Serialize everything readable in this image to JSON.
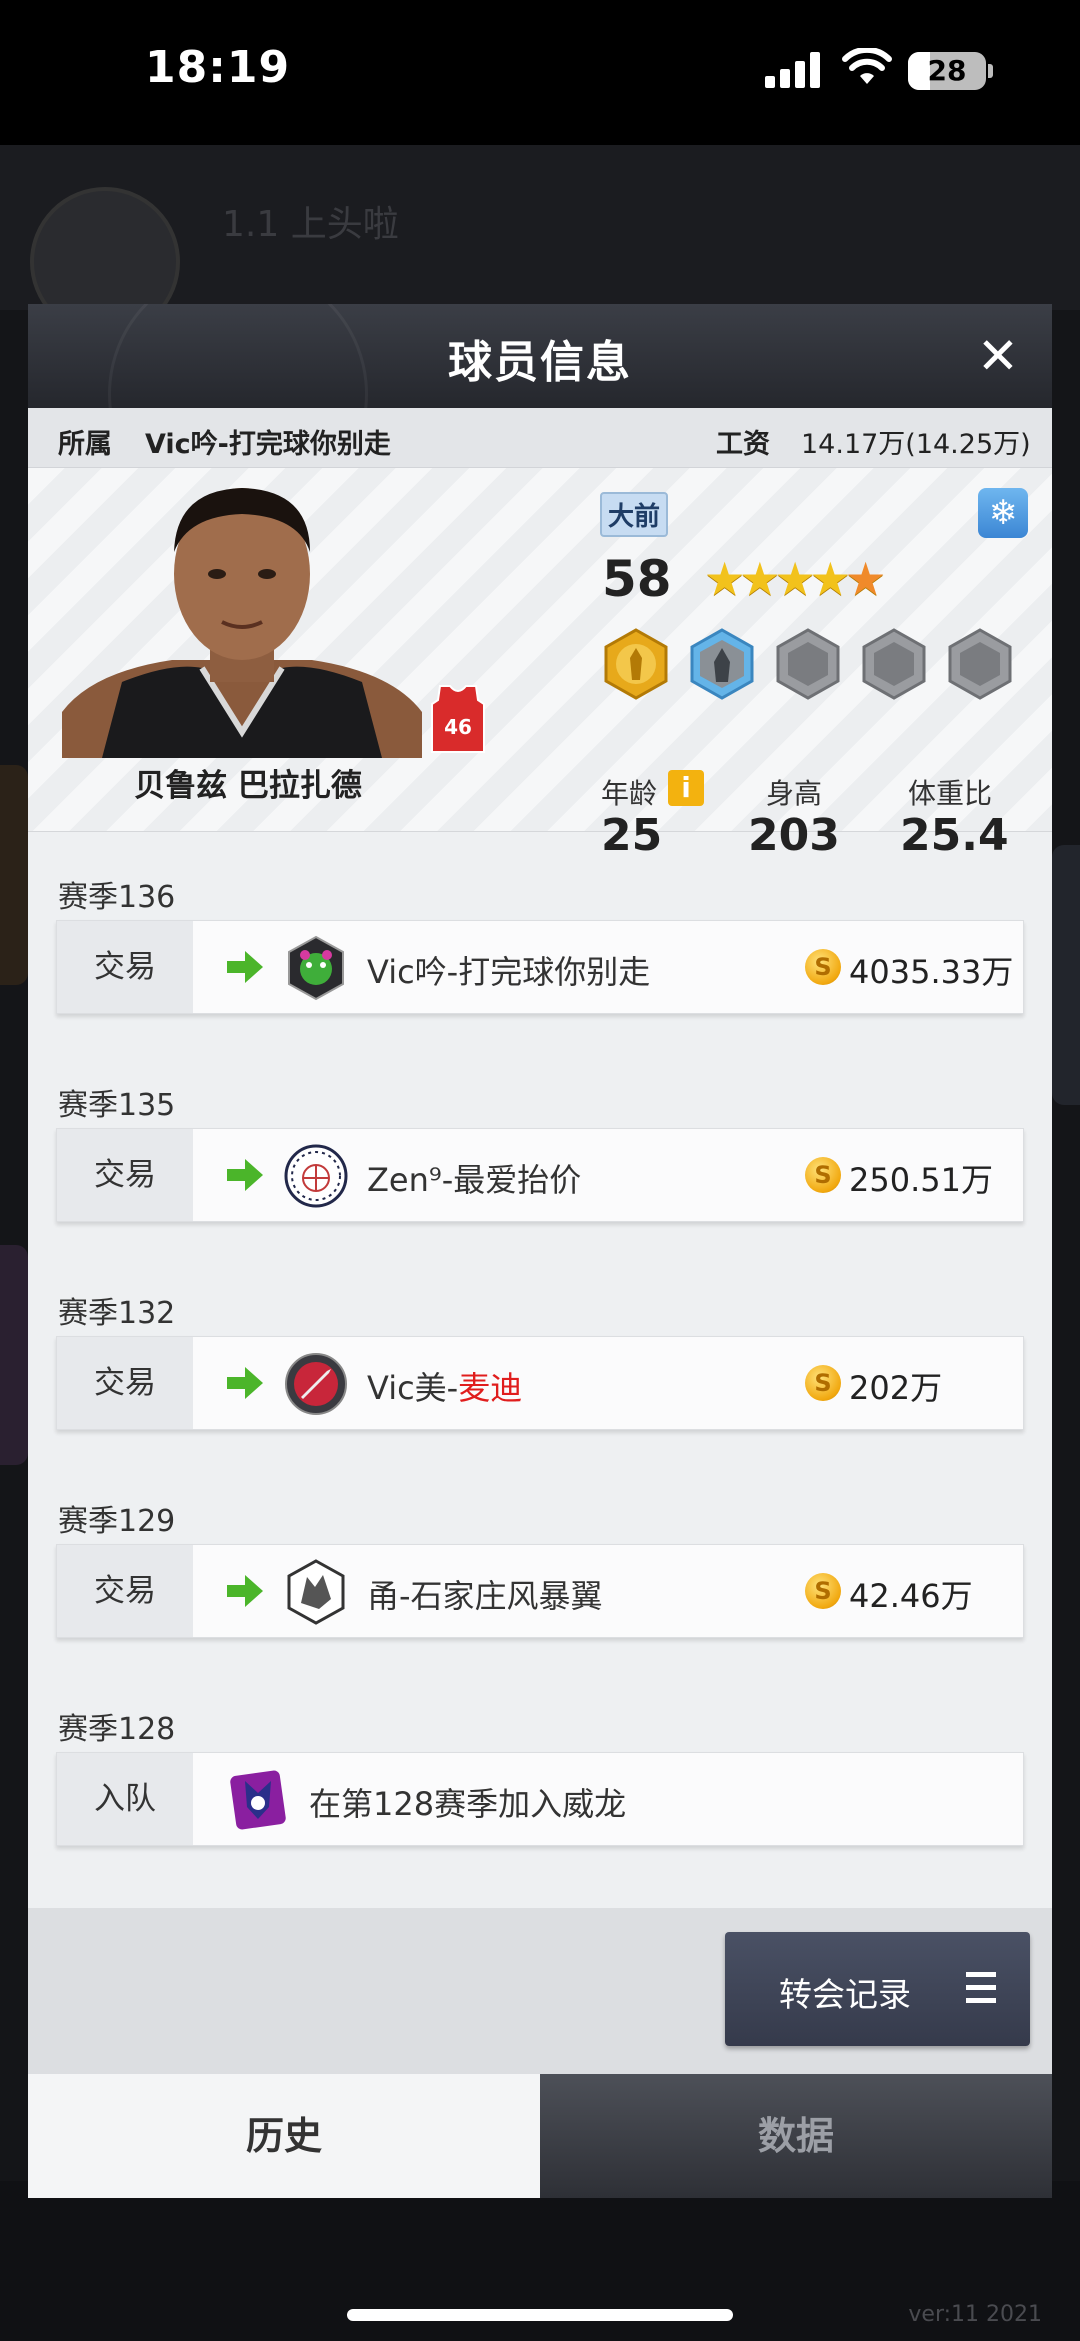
{
  "status_bar": {
    "time": "18:19",
    "battery": "28"
  },
  "background": {
    "name": "1.1 上头啦",
    "version": "ver:11  2021"
  },
  "modal": {
    "title": "球员信息",
    "close_icon": "close-icon"
  },
  "info_bar": {
    "team_label": "所属",
    "team_value": "Vic吟-打完球你别走",
    "salary_label": "工资",
    "salary_value": "14.17万(14.25万)"
  },
  "player": {
    "name": "贝鲁兹 巴拉扎德",
    "jersey_number": "46",
    "position": "大前",
    "rating": "58",
    "stars": 4.5,
    "age_label": "年龄",
    "age": "25",
    "height_label": "身高",
    "height": "203",
    "weight_label": "体重比",
    "weight": "25.4",
    "colors": {
      "jersey": "#d92b2b",
      "badge_gold": "#e7a91b",
      "badge_blue": "#64b4e8",
      "badge_locked": "#7a7c80"
    }
  },
  "history": [
    {
      "season": "赛季136",
      "type": "交易",
      "team": "Vic吟-打完球你别走",
      "team_red": "",
      "price": "4035.33万",
      "logo": "bear-logo"
    },
    {
      "season": "赛季135",
      "type": "交易",
      "team": "Zen⁹-最爱抬价",
      "team_red": "",
      "price": "250.51万",
      "logo": "basketball-logo"
    },
    {
      "season": "赛季132",
      "type": "交易",
      "team": "Vic美-",
      "team_red": "麦迪",
      "price": "202万",
      "logo": "rocket-logo"
    },
    {
      "season": "赛季129",
      "type": "交易",
      "team": "甬-石家庄风暴翼",
      "team_red": "",
      "price": "42.46万",
      "logo": "wolf-logo"
    },
    {
      "season": "赛季128",
      "type": "入队",
      "team": "在第128赛季加入威龙",
      "team_red": "",
      "price": "",
      "logo": "raptor-logo"
    }
  ],
  "buttons": {
    "transfer": "转会记录"
  },
  "tabs": {
    "history": "历史",
    "data": "数据"
  }
}
